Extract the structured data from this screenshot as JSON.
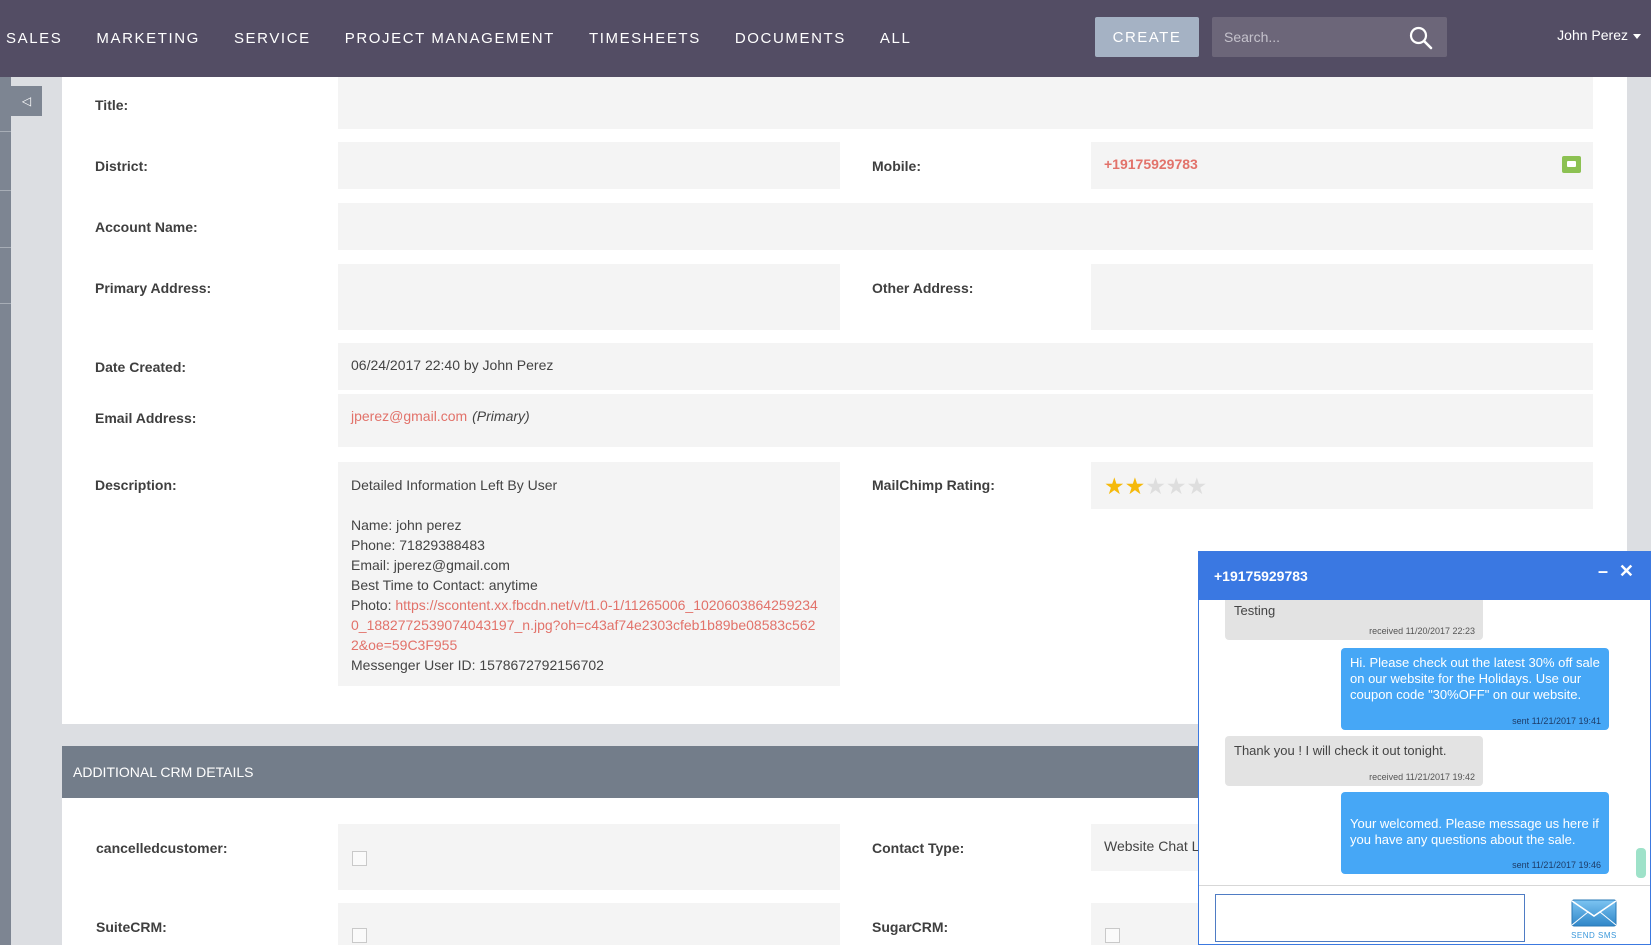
{
  "nav": {
    "items": [
      "SALES",
      "MARKETING",
      "SERVICE",
      "PROJECT MANAGEMENT",
      "TIMESHEETS",
      "DOCUMENTS",
      "ALL"
    ],
    "create_label": "CREATE",
    "search_placeholder": "Search...",
    "user_name": "John Perez"
  },
  "form": {
    "title_label": "Title:",
    "district_label": "District:",
    "mobile_label": "Mobile:",
    "mobile_value": "+19175929783",
    "account_label": "Account Name:",
    "primary_address_label": "Primary Address:",
    "other_address_label": "Other Address:",
    "date_created_label": "Date Created:",
    "date_created_value": "06/24/2017 22:40 by John Perez",
    "email_label": "Email Address:",
    "email_value": "jperez@gmail.com",
    "email_tag": "(Primary)",
    "description_label": "Description:",
    "description": {
      "heading": "Detailed Information Left By User",
      "name": "Name: john perez",
      "phone": "Phone: 71829388483",
      "email": "Email: jperez@gmail.com",
      "best_time": "Best Time to Contact: anytime",
      "photo_prefix": "Photo: ",
      "photo_link": "https://scontent.xx.fbcdn.net/v/t1.0-1/11265006_10206038642592340_1882772539074043197_n.jpg?oh=c43af74e2303cfeb1b89be08583c5622&oe=59C3F955",
      "messenger_id": "Messenger User ID: 1578672792156702"
    },
    "mailchimp_label": "MailChimp Rating:",
    "mailchimp_rating": 2,
    "mailchimp_max": 5
  },
  "additional": {
    "header": "ADDITIONAL CRM DETAILS",
    "cancelled_label": "cancelledcustomer:",
    "contact_type_label": "Contact Type:",
    "contact_type_value": "Website Chat Le",
    "suitecrm_label": "SuiteCRM:",
    "sugarcrm_label": "SugarCRM:"
  },
  "chat": {
    "number": "+19175929783",
    "minimize_glyph": "–",
    "close_glyph": "✕",
    "messages": [
      {
        "direction": "in",
        "text": "Testing",
        "meta": "received 11/20/2017 22:23"
      },
      {
        "direction": "out",
        "text": "Hi. Please check out the latest 30% off sale on our website for the Holidays. Use our coupon code \"30%OFF\" on our website.",
        "meta": "sent 11/21/2017 19:41"
      },
      {
        "direction": "in",
        "text": "Thank you ! I will check it out tonight.",
        "meta": "received 11/21/2017 19:42"
      },
      {
        "direction": "out",
        "text": "Your welcomed. Please message us here if you have any questions about the sale.",
        "meta": "sent 11/21/2017 19:46"
      }
    ],
    "send_label": "SEND SMS"
  },
  "colors": {
    "topbar": "#534d64",
    "accent_link": "#e2726a",
    "chat_header": "#3a78e2",
    "outgoing_bubble": "#46a7f6",
    "star_on": "#f5b90b"
  },
  "icons": [
    "search-icon",
    "collapse-sidebar-icon",
    "sms-icon",
    "star-icon",
    "minimize-icon",
    "close-icon",
    "envelope-icon"
  ]
}
